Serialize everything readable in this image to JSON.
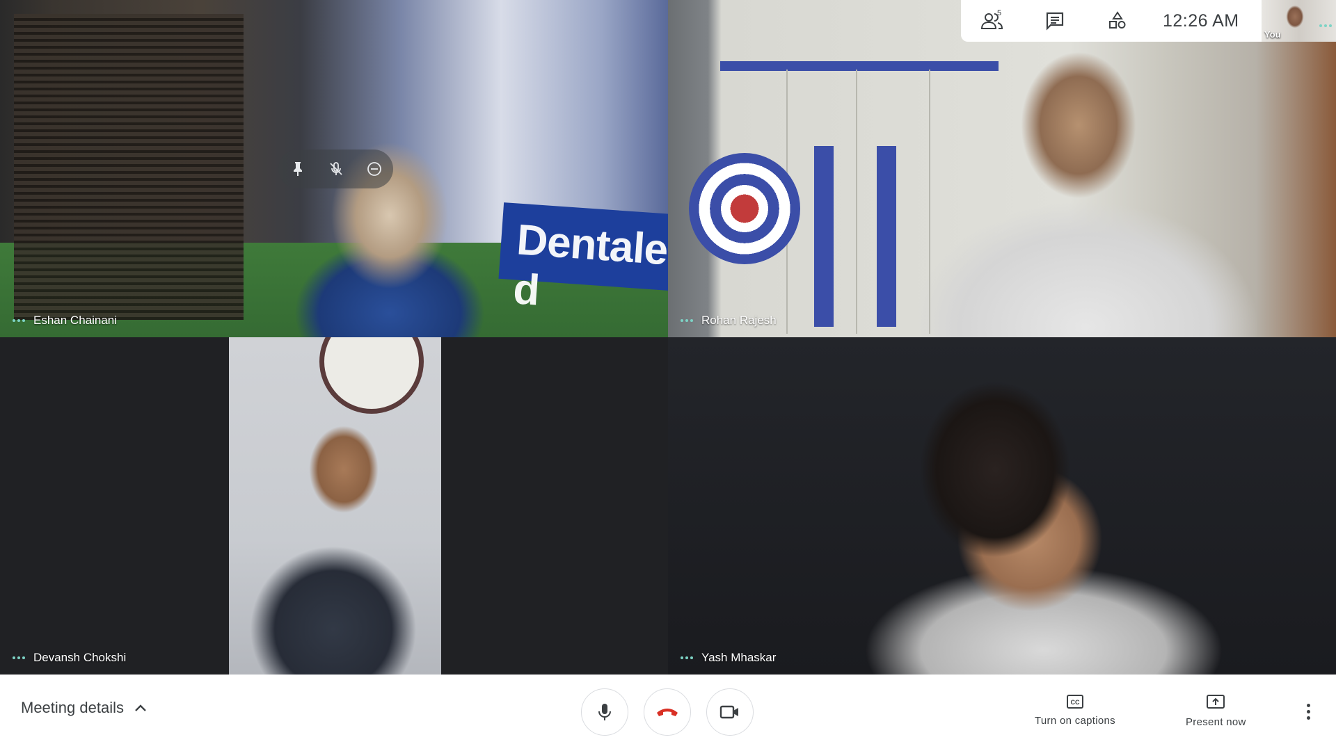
{
  "participants": [
    {
      "name": "Eshan Chainani"
    },
    {
      "name": "Rohan Rajesh"
    },
    {
      "name": "Devansh Chokshi"
    },
    {
      "name": "Yash Mhaskar"
    }
  ],
  "video_text": {
    "banner": "Dentales d"
  },
  "top_bar": {
    "people_count": "5",
    "time": "12:26 AM",
    "self_label": "You",
    "icons": [
      "people-icon",
      "chat-icon",
      "activities-icon"
    ]
  },
  "tile_controls": {
    "icons": [
      "pin-icon",
      "mic-off-icon",
      "remove-icon"
    ]
  },
  "bottom_bar": {
    "meeting_details": "Meeting details",
    "captions": "Turn on captions",
    "present": "Present now",
    "icons": [
      "chevron-up-icon",
      "mic-icon",
      "hang-up-icon",
      "camera-icon",
      "captions-icon",
      "present-icon",
      "more-vert-icon"
    ]
  },
  "colors": {
    "hangup": "#d93025",
    "indicator": "#7dd3c5",
    "tile_bg": "#202124",
    "icon": "#3c4043"
  }
}
